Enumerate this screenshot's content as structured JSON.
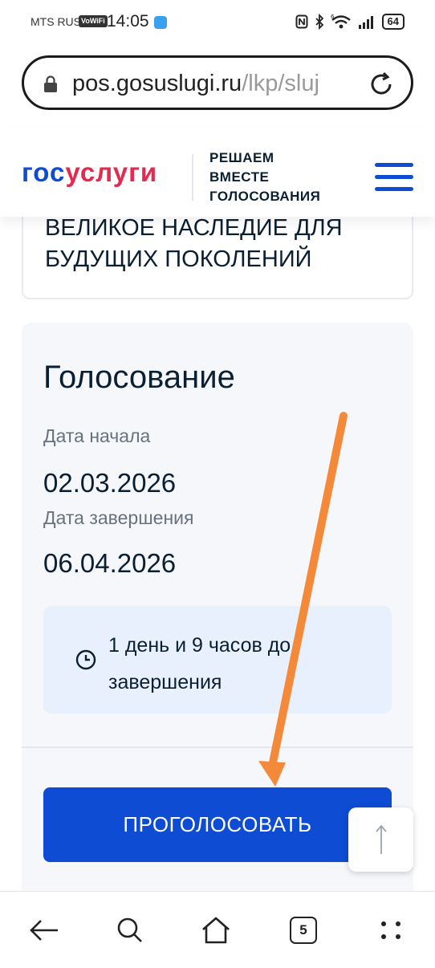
{
  "status_bar": {
    "carrier": "MTS RUS",
    "volte": "VoWiFi",
    "time": "14:05",
    "battery": "64",
    "icons": [
      "nfc-icon",
      "bluetooth-icon",
      "wifi-6-icon",
      "signal-icon",
      "battery-icon"
    ]
  },
  "browser": {
    "url_host": "pos.gosuslugi.ru",
    "url_path": "/lkp/sluj"
  },
  "header": {
    "logo_part1": "гос",
    "logo_part2": "услуги",
    "tagline_line1": "РЕШАЕМ",
    "tagline_line2": "ВМЕСТЕ",
    "tagline_line3": "ГОЛОСОВАНИЯ"
  },
  "poll": {
    "title": "ВЕЛИКОЕ НАСЛЕДИЕ ДЛЯ БУДУЩИХ ПОКОЛЕНИЙ"
  },
  "voting": {
    "heading": "Голосование",
    "start_label": "Дата начала",
    "start_value": "02.03.2026",
    "end_label": "Дата завершения",
    "end_value": "06.04.2026",
    "countdown": "1 день и 9 часов до завершения",
    "vote_button": "ПРОГОЛОСОВАТЬ"
  },
  "annotation": {
    "arrow_color": "#f5893a"
  },
  "nav": {
    "tabs_count": "5"
  },
  "colors": {
    "brand_blue": "#0d4cd3",
    "brand_red": "#e52a4f",
    "card_bg": "#f5f7fa",
    "countdown_bg": "#e8f0fe"
  }
}
